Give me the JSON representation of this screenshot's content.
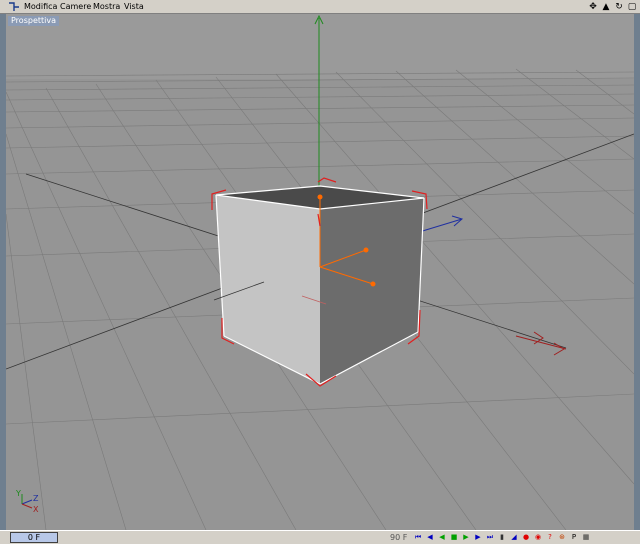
{
  "menubar": {
    "items": [
      "Modifica",
      "Camere",
      "Mostra",
      "Vista"
    ],
    "nav_icons": [
      "move-view-icon",
      "zoom-view-icon",
      "rotate-view-icon",
      "maximize-view-icon"
    ]
  },
  "viewport": {
    "label": "Prospettiva",
    "axis_gizmo": {
      "y": "Y",
      "z": "Z",
      "x": "X"
    }
  },
  "timeline": {
    "current_frame": "0 F",
    "end_frame": "90 F",
    "colors": {
      "play": "#00a000",
      "nav": "#0000c0",
      "record": "#e00000"
    }
  }
}
